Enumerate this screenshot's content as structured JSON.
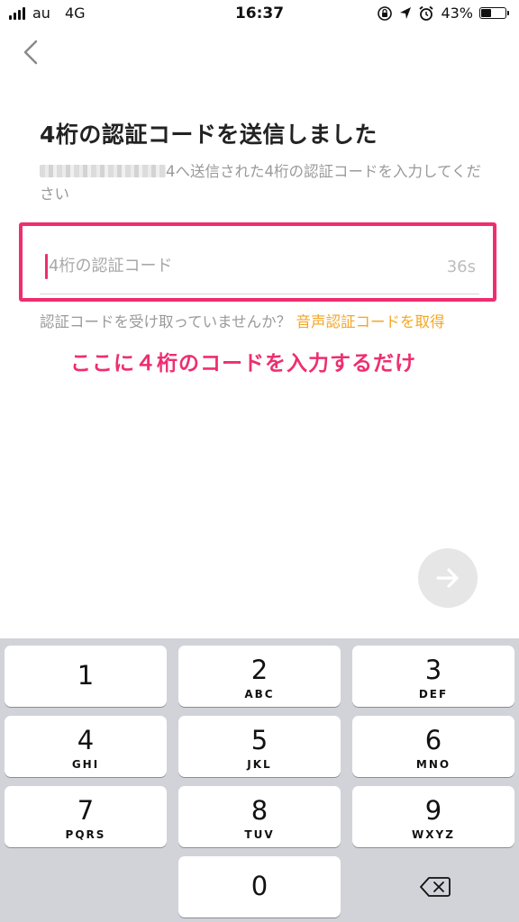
{
  "status_bar": {
    "carrier": "au",
    "network": "4G",
    "time": "16:37",
    "battery_percent": "43%",
    "battery_level": 0.43
  },
  "header": {
    "back_icon": "chevron-left-icon"
  },
  "main": {
    "title": "4桁の認証コードを送信しました",
    "description_suffix": "4へ送信された4桁の認証コードを入力してください",
    "code_input_placeholder": "4桁の認証コード",
    "code_input_value": "",
    "countdown": "36s",
    "resend_text": "認証コードを受け取っていませんか？",
    "resend_link": "音声認証コードを取得",
    "annotation": "ここに４桁のコードを入力するだけ",
    "next_icon": "arrow-right-icon"
  },
  "keyboard": {
    "keys": [
      {
        "num": "1",
        "letters": ""
      },
      {
        "num": "2",
        "letters": "ABC"
      },
      {
        "num": "3",
        "letters": "DEF"
      },
      {
        "num": "4",
        "letters": "GHI"
      },
      {
        "num": "5",
        "letters": "JKL"
      },
      {
        "num": "6",
        "letters": "MNO"
      },
      {
        "num": "7",
        "letters": "PQRS"
      },
      {
        "num": "8",
        "letters": "TUV"
      },
      {
        "num": "9",
        "letters": "WXYZ"
      },
      {
        "num": "0",
        "letters": ""
      }
    ],
    "delete_icon": "backspace-icon"
  },
  "colors": {
    "accent_pink": "#ee2e70",
    "link_orange": "#f5a623",
    "keyboard_bg": "#d1d3d9"
  }
}
